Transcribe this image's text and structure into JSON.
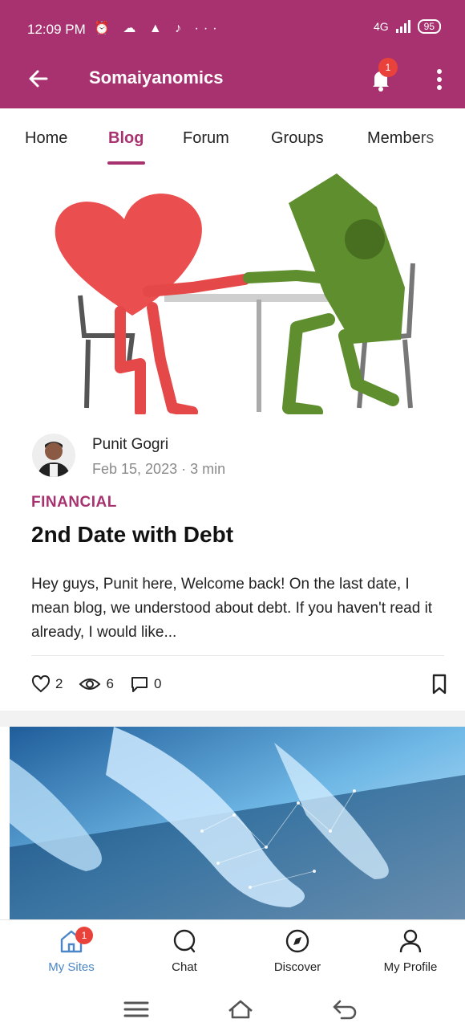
{
  "status_bar": {
    "time": "12:09 PM",
    "icons": "⏰ ☁ ▲ ♪ ···",
    "network": "4G",
    "battery": "95"
  },
  "app_bar": {
    "title": "Somaiyanomics",
    "notification_count": "1"
  },
  "tabs": [
    {
      "label": "Home"
    },
    {
      "label": "Blog"
    },
    {
      "label": "Forum"
    },
    {
      "label": "Groups"
    },
    {
      "label": "Members"
    }
  ],
  "post": {
    "author": "Punit Gogri",
    "meta": "Feb 15, 2023 · 3 min",
    "category": "FINANCIAL",
    "title": "2nd Date with Debt",
    "excerpt": "Hey guys, Punit here, Welcome back! On the last date, I mean blog, we understood about debt. If you haven't read it already, I would like...",
    "likes": "2",
    "views": "6",
    "comments": "0"
  },
  "bottom_nav": {
    "items": [
      {
        "label": "My Sites"
      },
      {
        "label": "Chat"
      },
      {
        "label": "Discover"
      },
      {
        "label": "My Profile"
      }
    ],
    "badge": "1"
  },
  "colors": {
    "brand": "#a8326f",
    "active_nav": "#4a86c8",
    "badge": "#e8423a"
  }
}
